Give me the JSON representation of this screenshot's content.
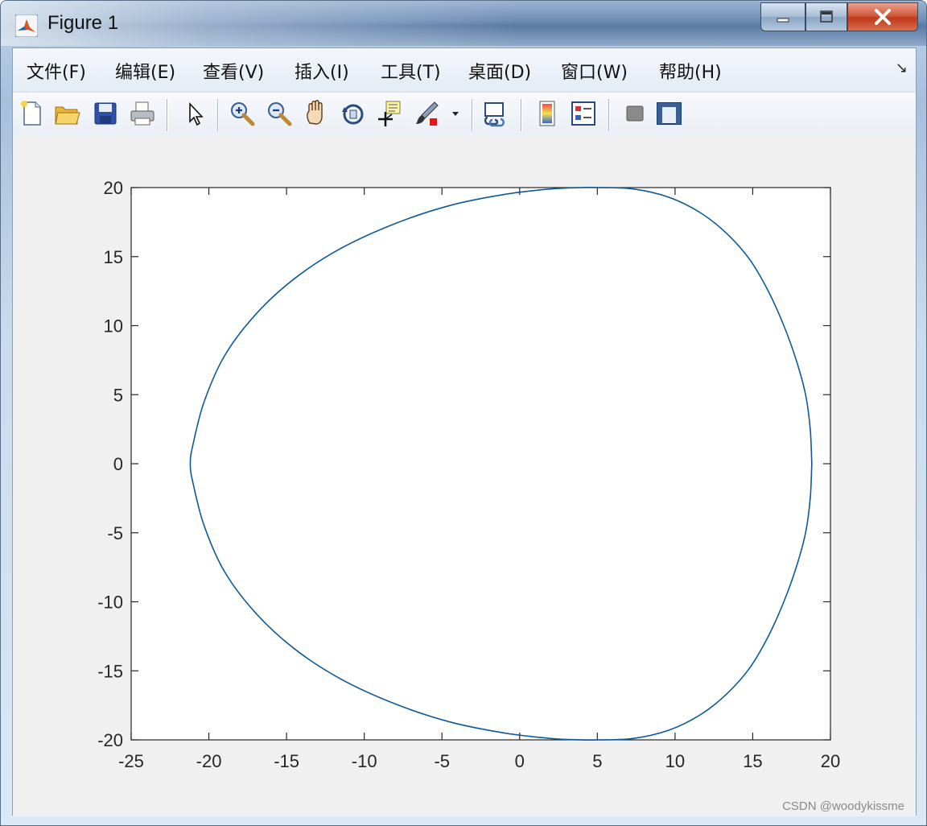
{
  "window": {
    "title": "Figure 1",
    "controls": {
      "minimize": "minimize",
      "maximize": "maximize",
      "close": "close"
    }
  },
  "menubar": {
    "items": [
      "文件(F)",
      "编辑(E)",
      "查看(V)",
      "插入(I)",
      "工具(T)",
      "桌面(D)",
      "窗口(W)",
      "帮助(H)"
    ],
    "overflow_glyph": "↘"
  },
  "toolbar": {
    "buttons": [
      {
        "icon": "new-figure-icon"
      },
      {
        "icon": "open-file-icon"
      },
      {
        "icon": "save-icon"
      },
      {
        "icon": "print-icon"
      },
      {
        "icon": "edit-plot-icon"
      },
      {
        "icon": "zoom-in-icon"
      },
      {
        "icon": "zoom-out-icon"
      },
      {
        "icon": "pan-icon"
      },
      {
        "icon": "rotate-3d-icon"
      },
      {
        "icon": "data-cursor-icon"
      },
      {
        "icon": "brush-icon"
      },
      {
        "icon": "link-plot-icon"
      },
      {
        "icon": "colorbar-icon"
      },
      {
        "icon": "legend-icon"
      },
      {
        "icon": "hide-plot-tools-icon"
      },
      {
        "icon": "show-plot-tools-icon"
      }
    ]
  },
  "colors": {
    "line": "#0f5a96",
    "axes_bg": "#ffffff",
    "figure_bg": "#f0f0f0"
  },
  "chart_data": {
    "type": "line",
    "title": "",
    "xlabel": "",
    "ylabel": "",
    "xlim": [
      -25,
      20
    ],
    "ylim": [
      -20,
      20
    ],
    "xticks": [
      -25,
      -20,
      -15,
      -10,
      -5,
      0,
      5,
      10,
      15,
      20
    ],
    "yticks": [
      -20,
      -15,
      -10,
      -5,
      0,
      5,
      10,
      15,
      20
    ],
    "xtick_labels": [
      "-25",
      "-20",
      "-15",
      "-10",
      "-5",
      "0",
      "5",
      "10",
      "15",
      "20"
    ],
    "ytick_labels": [
      "-20",
      "-15",
      "-10",
      "-5",
      "0",
      "5",
      "10",
      "15",
      "20"
    ],
    "grid": false,
    "series": [
      {
        "x": [
          18.8,
          18.7,
          18.4,
          17.8,
          17.0,
          16.0,
          14.8,
          13.3,
          11.6,
          9.6,
          7.3,
          5.0,
          4.0,
          2.0,
          -1.0,
          -4.5,
          -8.0,
          -11.5,
          -14.5,
          -17.0,
          -19.0,
          -20.3,
          -21.0,
          -21.2,
          -21.0,
          -20.3,
          -19.0,
          -17.0,
          -14.5,
          -11.5,
          -8.0,
          -4.5,
          -1.0,
          2.0,
          4.0,
          5.0,
          7.3,
          9.6,
          11.6,
          13.3,
          14.8,
          16.0,
          17.0,
          17.8,
          18.4,
          18.7,
          18.8
        ],
        "y": [
          0,
          2.5,
          5.0,
          7.5,
          10.0,
          12.5,
          14.8,
          16.7,
          18.2,
          19.3,
          19.9,
          20.0,
          20.0,
          19.9,
          19.5,
          18.7,
          17.4,
          15.6,
          13.4,
          10.8,
          7.8,
          4.5,
          1.5,
          0,
          -1.5,
          -4.5,
          -7.8,
          -10.8,
          -13.4,
          -15.6,
          -17.4,
          -18.7,
          -19.5,
          -19.9,
          -20.0,
          -20.0,
          -19.9,
          -19.3,
          -18.2,
          -16.7,
          -14.8,
          -12.5,
          -10.0,
          -7.5,
          -5.0,
          -2.5,
          0
        ]
      }
    ]
  },
  "watermark": "CSDN @woodykissme"
}
